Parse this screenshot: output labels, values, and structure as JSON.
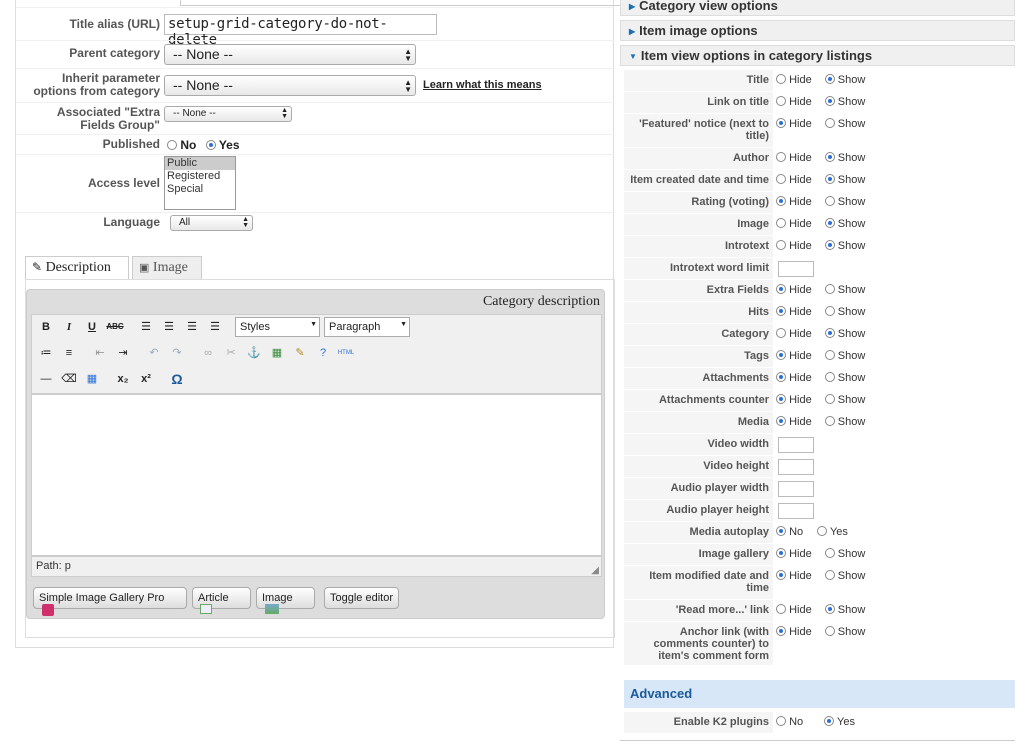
{
  "left_form": {
    "title_alias_label": "Title alias (URL)",
    "title_alias_value": "setup-grid-category-do-not-delete",
    "parent_category_label": "Parent category",
    "parent_category_value": "-- None --",
    "inherit_label": "Inherit parameter options from category",
    "inherit_value": "-- None --",
    "learn_link": "Learn what this means",
    "extra_fields_label": "Associated \"Extra Fields Group\"",
    "extra_fields_value": "-- None --",
    "published_label": "Published",
    "published_no": "No",
    "published_yes": "Yes",
    "access_label": "Access level",
    "access_options": [
      "Public",
      "Registered",
      "Special"
    ],
    "access_selected": "Public",
    "language_label": "Language",
    "language_value": "All"
  },
  "tabs": {
    "description": "Description",
    "image": "Image"
  },
  "editor": {
    "title": "Category description",
    "styles": "Styles",
    "paragraph": "Paragraph",
    "path": "Path: p",
    "buttons": [
      "Simple Image Gallery Pro",
      "Article",
      "Image",
      "Toggle editor"
    ]
  },
  "right_panel": {
    "category_view_options": "Category view options",
    "item_image_options": "Item image options",
    "item_view_options": "Item view options in category listings",
    "hide": "Hide",
    "show": "Show",
    "no": "No",
    "yes": "Yes",
    "options": [
      {
        "label": "Title",
        "value": "Show"
      },
      {
        "label": "Link on title",
        "value": "Show"
      },
      {
        "label": "'Featured' notice (next to title)",
        "value": "Hide"
      },
      {
        "label": "Author",
        "value": "Show"
      },
      {
        "label": "Item created date and time",
        "value": "Show"
      },
      {
        "label": "Rating (voting)",
        "value": "Hide"
      },
      {
        "label": "Image",
        "value": "Show"
      },
      {
        "label": "Introtext",
        "value": "Show"
      },
      {
        "label": "Introtext word limit",
        "value": ""
      },
      {
        "label": "Extra Fields",
        "value": "Hide"
      },
      {
        "label": "Hits",
        "value": "Hide"
      },
      {
        "label": "Category",
        "value": "Show"
      },
      {
        "label": "Tags",
        "value": "Hide"
      },
      {
        "label": "Attachments",
        "value": "Hide"
      },
      {
        "label": "Attachments counter",
        "value": "Hide"
      },
      {
        "label": "Media",
        "value": "Hide"
      },
      {
        "label": "Video width",
        "value": ""
      },
      {
        "label": "Video height",
        "value": ""
      },
      {
        "label": "Audio player width",
        "value": ""
      },
      {
        "label": "Audio player height",
        "value": ""
      },
      {
        "label": "Media autoplay",
        "value": "No"
      },
      {
        "label": "Image gallery",
        "value": "Hide"
      },
      {
        "label": "Item modified date and time",
        "value": "Hide"
      },
      {
        "label": "'Read more...' link",
        "value": "Show"
      },
      {
        "label": "Anchor link (with comments counter) to item's comment form",
        "value": "Hide"
      }
    ],
    "advanced_header": "Advanced",
    "enable_k2_plugins_label": "Enable K2 plugins",
    "enable_k2_plugins_value": "Yes"
  },
  "colors": {
    "accent": "#2a6fd6",
    "advanced_bg": "#d7e7f7",
    "link_blue": "#1a6fb5"
  }
}
